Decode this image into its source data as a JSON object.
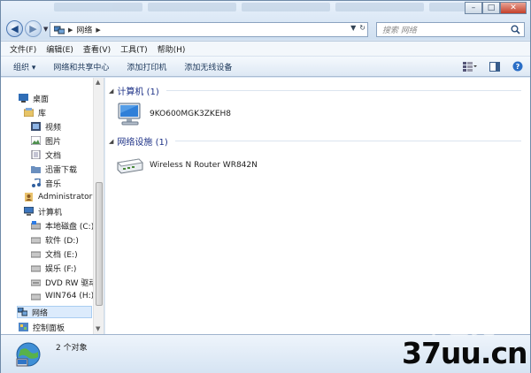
{
  "address": {
    "crumb": "网络",
    "search_placeholder": "搜索 网络"
  },
  "menu": [
    "文件(F)",
    "编辑(E)",
    "查看(V)",
    "工具(T)",
    "帮助(H)"
  ],
  "toolbar": [
    "组织 ▾",
    "网络和共享中心",
    "添加打印机",
    "添加无线设备"
  ],
  "window_controls": {
    "minimize": "–",
    "maximize": "□",
    "close": "✕"
  },
  "nav_items": [
    {
      "label": "桌面",
      "icon": "desktop-icon"
    },
    {
      "label": "库",
      "icon": "library-icon"
    },
    {
      "label": "视频",
      "icon": "video-icon"
    },
    {
      "label": "图片",
      "icon": "pictures-icon"
    },
    {
      "label": "文档",
      "icon": "documents-icon"
    },
    {
      "label": "迅雷下载",
      "icon": "folder-icon"
    },
    {
      "label": "音乐",
      "icon": "music-icon"
    },
    {
      "label": "Administrator",
      "icon": "user-icon"
    },
    {
      "label": "计算机",
      "icon": "computer-icon"
    },
    {
      "label": "本地磁盘 (C:)",
      "icon": "drive-icon"
    },
    {
      "label": "软件 (D:)",
      "icon": "drive-icon"
    },
    {
      "label": "文档 (E:)",
      "icon": "drive-icon"
    },
    {
      "label": "娱乐 (F:)",
      "icon": "drive-icon"
    },
    {
      "label": "DVD RW 驱动",
      "icon": "dvd-icon"
    },
    {
      "label": "WIN764 (H:)",
      "icon": "drive-icon"
    },
    {
      "label": "网络",
      "icon": "network-icon"
    },
    {
      "label": "控制面板",
      "icon": "control-panel-icon"
    }
  ],
  "groups": [
    {
      "title": "计算机 (1)",
      "items": [
        {
          "label": "9KO600MGK3ZKEH8",
          "icon": "computer-icon"
        }
      ]
    },
    {
      "title": "网络设施 (1)",
      "items": [
        {
          "label": "Wireless N Router WR842N",
          "icon": "router-icon"
        }
      ]
    }
  ],
  "status": {
    "count": "2 个对象"
  },
  "watermark": "37uu.cn"
}
